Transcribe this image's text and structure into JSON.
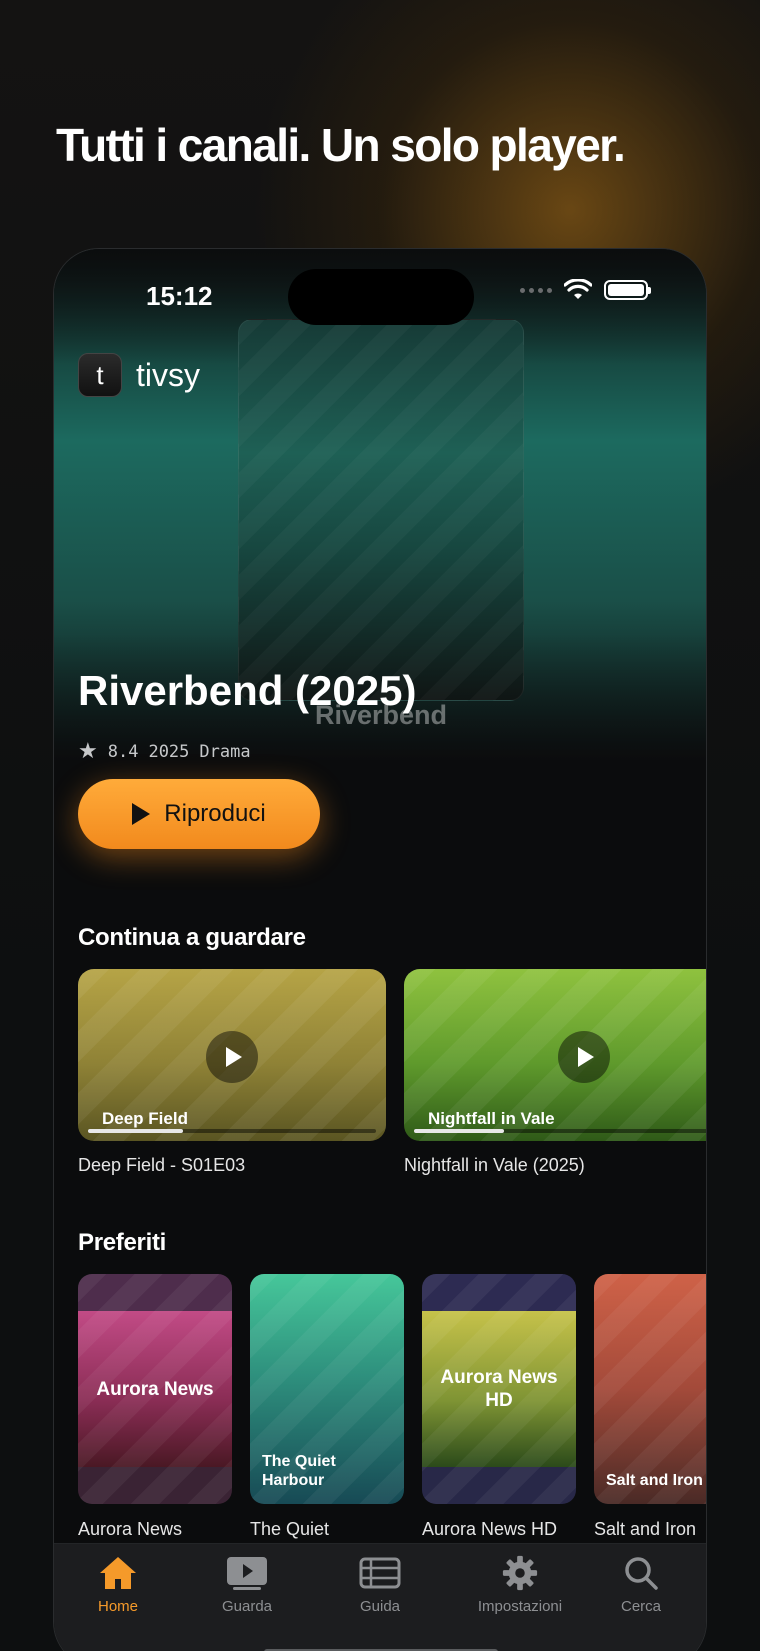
{
  "headline": "Tutti i canali. Un solo player.",
  "status_bar": {
    "time": "15:12"
  },
  "app": {
    "logo_letter": "t",
    "name": "tivsy"
  },
  "hero": {
    "poster_label": "Riverbend",
    "title": "Riverbend (2025)",
    "rating": "8.4",
    "year": "2025",
    "genre": "Drama",
    "play_label": "Riproduci"
  },
  "continue_watching": {
    "title": "Continua a guardare",
    "items": [
      {
        "label": "Deep Field",
        "caption": "Deep Field - S01E03",
        "progress": 0.33
      },
      {
        "label": "Nightfall in Vale",
        "caption": "Nightfall in Vale (2025)",
        "progress": 0.3
      }
    ]
  },
  "favorites": {
    "title": "Preferiti",
    "items": [
      {
        "label": "Aurora News",
        "caption": "Aurora News"
      },
      {
        "label": "The Quiet Harbour",
        "caption": "The Quiet"
      },
      {
        "label": "Aurora News HD",
        "caption": "Aurora News HD"
      },
      {
        "label": "Salt and Iron",
        "caption": "Salt and Iron"
      }
    ]
  },
  "tabs": [
    {
      "label": "Home",
      "icon": "home-icon",
      "active": true
    },
    {
      "label": "Guarda",
      "icon": "play-screen-icon",
      "active": false
    },
    {
      "label": "Guida",
      "icon": "guide-icon",
      "active": false
    },
    {
      "label": "Impostazioni",
      "icon": "gear-icon",
      "active": false
    },
    {
      "label": "Cerca",
      "icon": "search-icon",
      "active": false
    }
  ],
  "colors": {
    "accent": "#f59a2a",
    "tab_inactive": "#8d8f92"
  }
}
